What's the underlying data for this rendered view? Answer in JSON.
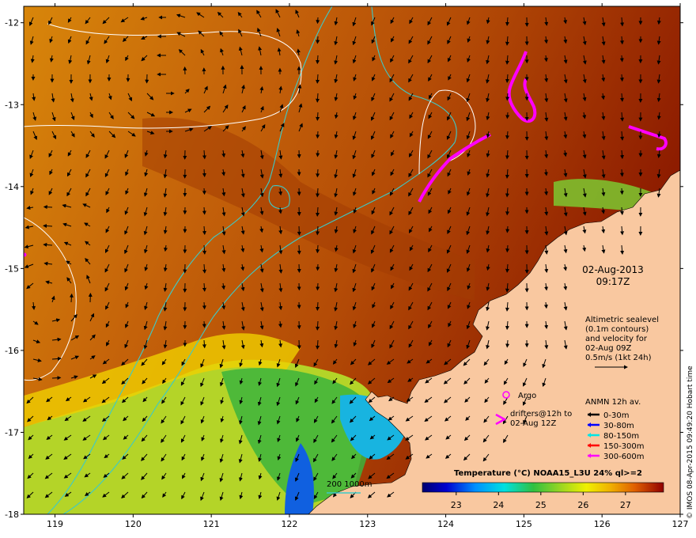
{
  "map": {
    "lon_range": [
      118.6,
      127
    ],
    "lat_range": [
      -18,
      -11.8
    ],
    "lon_ticks": [
      "119",
      "120",
      "121",
      "122",
      "123",
      "124",
      "125",
      "126",
      "127"
    ],
    "lat_ticks": [
      "-12",
      "-13",
      "-14",
      "-15",
      "-16",
      "-17",
      "-18"
    ]
  },
  "title": {
    "date": "02-Aug-2013",
    "time": "09:17Z"
  },
  "altimetry": {
    "line1": "Altimetric sealevel",
    "line2": "(0.1m contours)",
    "line3": "and velocity for",
    "line4": "02-Aug 09Z",
    "line5": "0.5m/s (1kt 24h)"
  },
  "legend": {
    "argo": "Argo",
    "drifters_line1": "drifters@12h to",
    "drifters_line2": "02-Aug 12Z",
    "anmn_title": "ANMN 12h av.",
    "depths": [
      {
        "label": "0-30m",
        "color": "#000000"
      },
      {
        "label": "30-80m",
        "color": "#0000ff"
      },
      {
        "label": "80-150m",
        "color": "#00e5e5"
      },
      {
        "label": "150-300m",
        "color": "#ff0000"
      },
      {
        "label": "300-600m",
        "color": "#ff00ff"
      }
    ],
    "isobath": "200  1000m"
  },
  "colorbar": {
    "title": "Temperature (°C) NOAA15_L3U 24% ql>=2",
    "ticks": [
      "23",
      "24",
      "25",
      "26",
      "27"
    ],
    "range": [
      22.2,
      27.9
    ]
  },
  "credit": "© IMOS 08-Apr-2015 09:49:20 Hobart time",
  "colors": {
    "land": "#f9c8a0",
    "warm": "#b84a00",
    "cool": "#9ccd28",
    "argo": "#ff00ff",
    "isobath": "#3ccac8",
    "contour": "#ffffff"
  }
}
